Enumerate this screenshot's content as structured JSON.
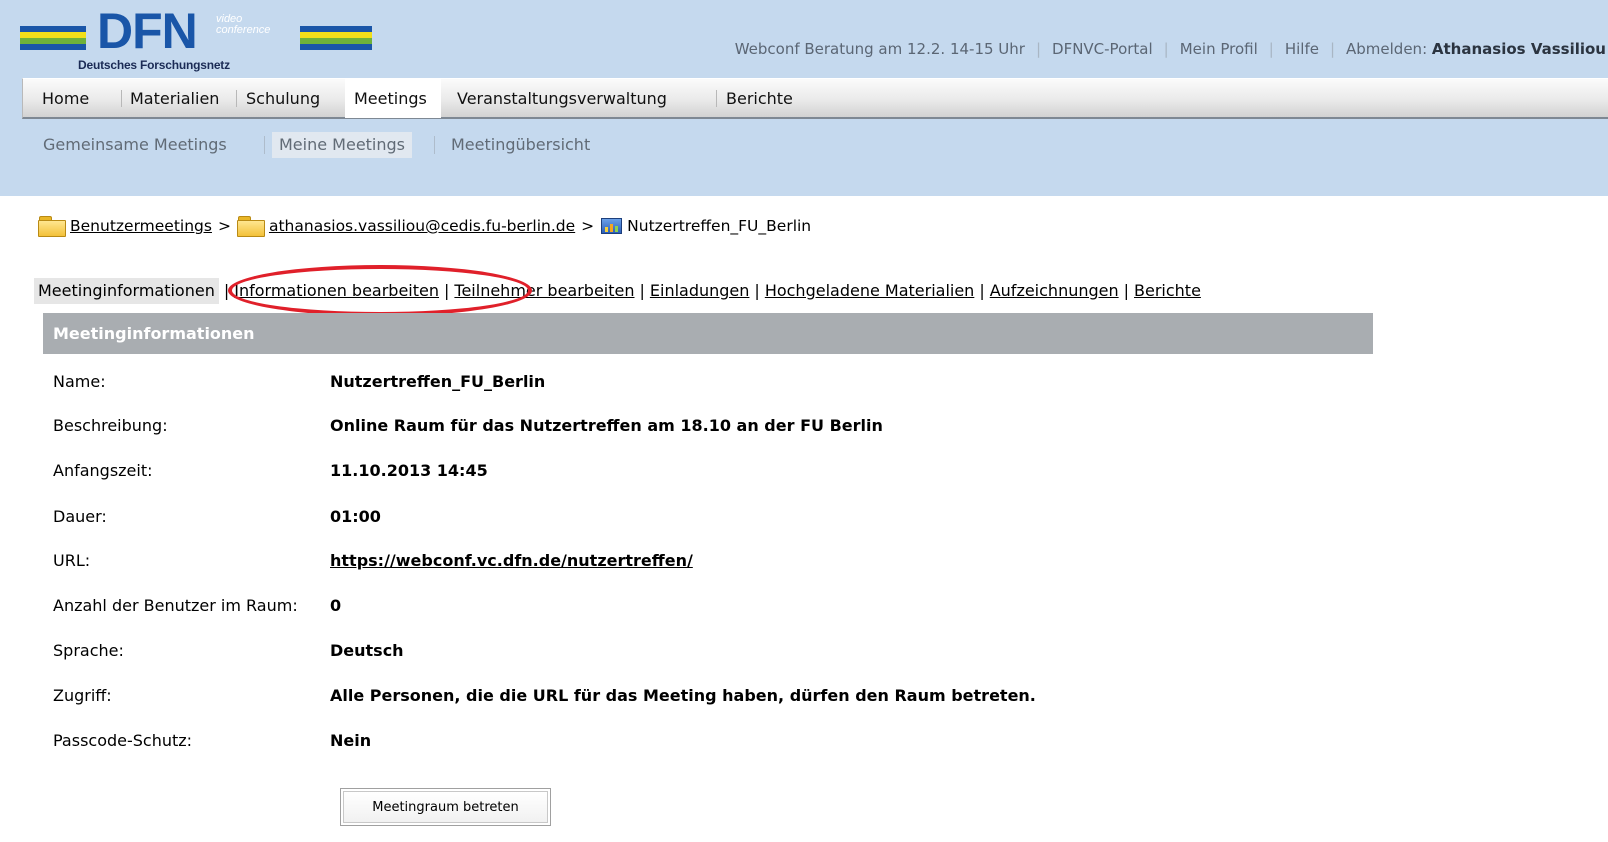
{
  "logo": {
    "name": "DFN",
    "video": "video",
    "conference": "conference",
    "subtitle": "Deutsches Forschungsnetz",
    "colors": [
      "#1a56a8",
      "#f2df1a",
      "#6fb23a",
      "#1a56a8"
    ]
  },
  "toplinks": {
    "notice": "Webconf Beratung am 12.2. 14-15 Uhr",
    "portal": "DFNVC-Portal",
    "profile": "Mein Profil",
    "help": "Hilfe",
    "logout": "Abmelden:",
    "user": "Athanasios Vassiliou"
  },
  "mainnav": {
    "items": [
      "Home",
      "Materialien",
      "Schulung",
      "Meetings",
      "Veranstaltungsverwaltung",
      "Berichte"
    ],
    "active": "Meetings"
  },
  "subnav": {
    "items": [
      "Gemeinsame Meetings",
      "Meine Meetings",
      "Meetingübersicht"
    ],
    "active": "Meine Meetings"
  },
  "breadcrumb": {
    "root": "Benutzermeetings",
    "sep": ">",
    "folder": "athanasios.vassiliou@cedis.fu-berlin.de",
    "meeting": "Nutzertreffen_FU_Berlin"
  },
  "tabs": {
    "current": "Meetinginformationen",
    "sep": "|",
    "edit_info": "Informationen bearbeiten",
    "edit_participants": "Teilnehmer bearbeiten",
    "invitations": "Einladungen",
    "uploaded": "Hochgeladene Materialien",
    "recordings": "Aufzeichnungen",
    "reports": "Berichte"
  },
  "panel": {
    "title": "Meetinginformationen",
    "rows": [
      {
        "label": "Name:",
        "value": "Nutzertreffen_FU_Berlin"
      },
      {
        "label": "Beschreibung:",
        "value": "Online Raum für das Nutzertreffen am 18.10 an der FU Berlin"
      },
      {
        "label": "Anfangszeit:",
        "value": "11.10.2013 14:45"
      },
      {
        "label": "Dauer:",
        "value": "01:00"
      },
      {
        "label": "URL:",
        "value": "https://webconf.vc.dfn.de/nutzertreffen/"
      },
      {
        "label": "Anzahl der Benutzer im Raum:",
        "value": "0"
      },
      {
        "label": "Sprache:",
        "value": "Deutsch"
      },
      {
        "label": "Zugriff:",
        "value": "Alle Personen, die die URL für das Meeting haben, dürfen den Raum betreten."
      },
      {
        "label": "Passcode-Schutz:",
        "value": "Nein"
      }
    ],
    "enter_button": "Meetingraum betreten"
  },
  "colors": {
    "header_bg": "#c5d9ee",
    "panel_head_bg": "#a9adb1",
    "highlight_ring": "#e0202a"
  }
}
